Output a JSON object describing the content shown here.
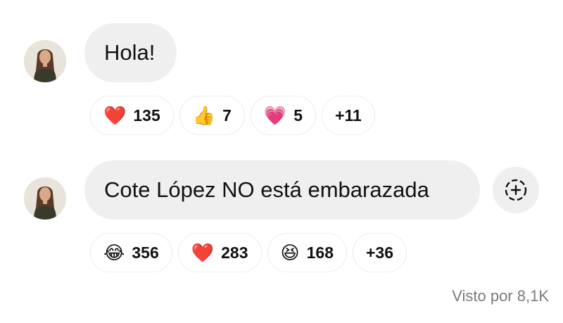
{
  "messages": [
    {
      "text": "Hola!",
      "reactions": [
        {
          "icon": "red-heart-icon",
          "emoji": "❤️",
          "count": "135"
        },
        {
          "icon": "thumbs-up-icon",
          "emoji": "👍",
          "count": "7"
        },
        {
          "icon": "pink-heart-icon",
          "emoji": "💗",
          "count": "5"
        },
        {
          "icon": null,
          "emoji": "",
          "count": "+11"
        }
      ]
    },
    {
      "text": "Cote López NO está embarazada",
      "reactions": [
        {
          "icon": "tears-of-joy-icon",
          "emoji": "😂",
          "count": "356"
        },
        {
          "icon": "red-heart-icon",
          "emoji": "❤️",
          "count": "283"
        },
        {
          "icon": "laughing-face-icon",
          "emoji": "😆",
          "count": "168"
        },
        {
          "icon": null,
          "emoji": "",
          "count": "+36"
        }
      ]
    }
  ],
  "seen_by": "Visto por 8,1K",
  "colors": {
    "bubble": "#efefef",
    "muted_text": "#7b7b7b",
    "pill_border": "#ececec"
  }
}
